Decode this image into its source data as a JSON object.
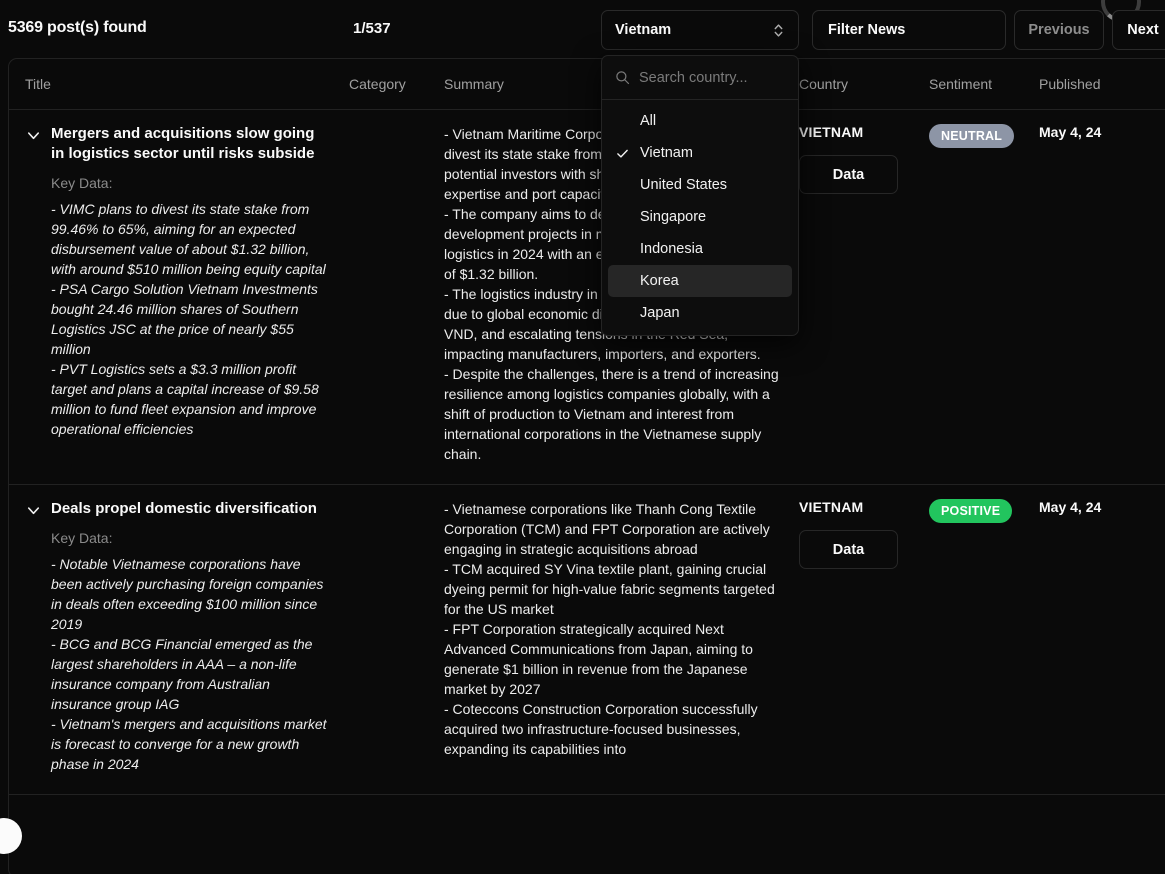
{
  "header": {
    "posts_found": "5369 post(s) found",
    "page_indicator": "1/537",
    "country_select_value": "Vietnam",
    "filter_news_label": "Filter News",
    "previous_label": "Previous",
    "next_label": "Next"
  },
  "dropdown": {
    "search_placeholder": "Search country...",
    "search_value": "",
    "items": [
      {
        "label": "All",
        "checked": false,
        "highlight": false
      },
      {
        "label": "Vietnam",
        "checked": true,
        "highlight": false
      },
      {
        "label": "United States",
        "checked": false,
        "highlight": false
      },
      {
        "label": "Singapore",
        "checked": false,
        "highlight": false
      },
      {
        "label": "Indonesia",
        "checked": false,
        "highlight": false
      },
      {
        "label": "Korea",
        "checked": false,
        "highlight": true
      },
      {
        "label": "Japan",
        "checked": false,
        "highlight": false
      }
    ]
  },
  "table": {
    "columns": {
      "title": "Title",
      "category": "Category",
      "summary": "Summary",
      "country": "Country",
      "sentiment": "Sentiment",
      "published": "Published"
    },
    "key_data_label": "Key Data:",
    "data_button_label": "Data",
    "rows": [
      {
        "title": "Mergers and acquisitions slow going in logistics sector until risks subside",
        "key_data": "- VIMC plans to divest its state stake from 99.46% to 65%, aiming for an expected disbursement value of about $1.32 billion, with around $510 million being equity capital\n- PSA Cargo Solution Vietnam Investments bought 24.46 million shares of Southern Logistics JSC at the price of nearly $55 million\n- PVT Logistics sets a $3.3 million profit target and plans a capital increase of $9.58 million to fund fleet expansion and improve operational efficiencies",
        "category": "",
        "summary": "- Vietnam Maritime Corporation (VIMC) plans to divest its state stake from 99.46% to 65% to attract potential investors with shipping lines, technology expertise and port capacity.\n- The company aims to deploy investment and development projects in maritime, seaports and logistics in 2024 with an expected disbursement value of $1.32 billion.\n- The logistics industry in Vietnam faces uncertainties due to global economic difficulties, devaluation of VND, and escalating tensions in the Red Sea, impacting manufacturers, importers, and exporters.\n- Despite the challenges, there is a trend of increasing resilience among logistics companies globally, with a shift of production to Vietnam and interest from international corporations in the Vietnamese supply chain.",
        "country": "VIETNAM",
        "sentiment": "NEUTRAL",
        "sentiment_kind": "neutral",
        "published": "May 4, 24"
      },
      {
        "title": "Deals propel domestic diversification",
        "key_data": "- Notable Vietnamese corporations have been actively purchasing foreign companies in deals often exceeding $100 million since 2019\n- BCG and BCG Financial emerged as the largest shareholders in AAA – a non-life insurance company from Australian insurance group IAG\n- Vietnam's mergers and acquisitions market is forecast to converge for a new growth phase in 2024",
        "category": "",
        "summary": "- Vietnamese corporations like Thanh Cong Textile Corporation (TCM) and FPT Corporation are actively engaging in strategic acquisitions abroad\n- TCM acquired SY Vina textile plant, gaining crucial dyeing permit for high-value fabric segments targeted for the US market\n- FPT Corporation strategically acquired Next Advanced Communications from Japan, aiming to generate $1 billion in revenue from the Japanese market by 2027\n- Coteccons Construction Corporation successfully acquired two infrastructure-focused businesses, expanding its capabilities into",
        "country": "VIETNAM",
        "sentiment": "POSITIVE",
        "sentiment_kind": "positive",
        "published": "May 4, 24"
      }
    ]
  },
  "colors": {
    "background": "#0a0a0a",
    "border": "#222222",
    "text": "#fafafa",
    "muted": "#8b8b8b",
    "positive": "#22c55e",
    "neutral": "#8d95a6",
    "highlight": "#262626"
  }
}
